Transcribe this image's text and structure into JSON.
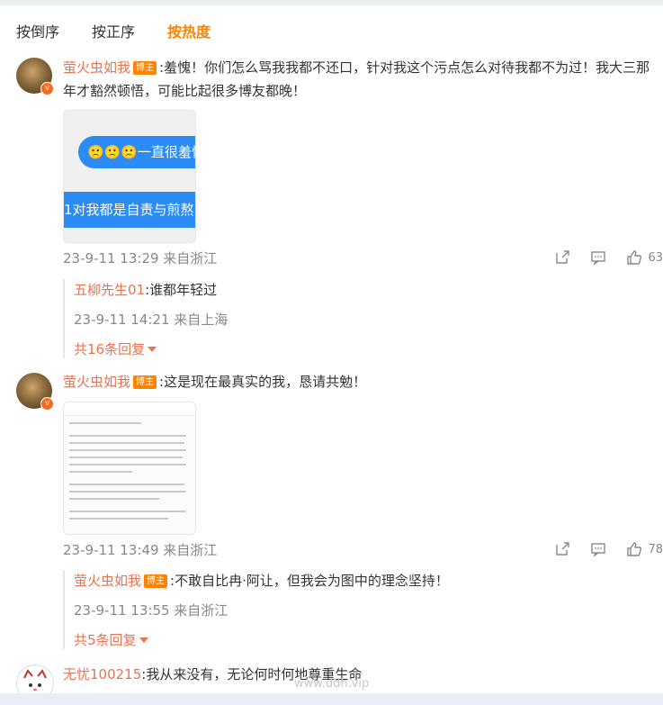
{
  "sort": {
    "tabs": [
      {
        "label": "按倒序",
        "active": false
      },
      {
        "label": "按正序",
        "active": false
      },
      {
        "label": "按热度",
        "active": true
      }
    ]
  },
  "comments": [
    {
      "author": "萤火虫如我",
      "badge": "博主",
      "text": ":羞愧！你们怎么骂我我都不还口，针对我这个污点怎么对待我都不为过！我大三那年才豁然顿悟，可能比起很多博友都晚！",
      "image_text_1": "🙁🙁🙁一直很羞愧",
      "image_text_2": "1对我都是自责与煎熬",
      "time": "23-9-11 13:29 来自浙江",
      "likes": "63",
      "reply": {
        "author": "五柳先生01",
        "text": ":谁都年轻过",
        "time": "23-9-11 14:21 来自上海",
        "more": "共16条回复"
      }
    },
    {
      "author": "萤火虫如我",
      "badge": "博主",
      "text": ":这是现在最真实的我，恳请共勉！",
      "time": "23-9-11 13:49 来自浙江",
      "likes": "78",
      "reply": {
        "author": "萤火虫如我",
        "badge": "博主",
        "text": ":不敢自比冉·阿让，但我会为图中的理念坚持！",
        "time": "23-9-11 13:55 来自浙江",
        "more": "共5条回复"
      }
    },
    {
      "author": "无忧100215",
      "text": ":我从来没有，无论何时何地尊重生命"
    }
  ],
  "watermark": "www.ddh.vip",
  "colors": {
    "accent": "#ff8200",
    "name": "#eb7350",
    "meta": "#888888"
  }
}
